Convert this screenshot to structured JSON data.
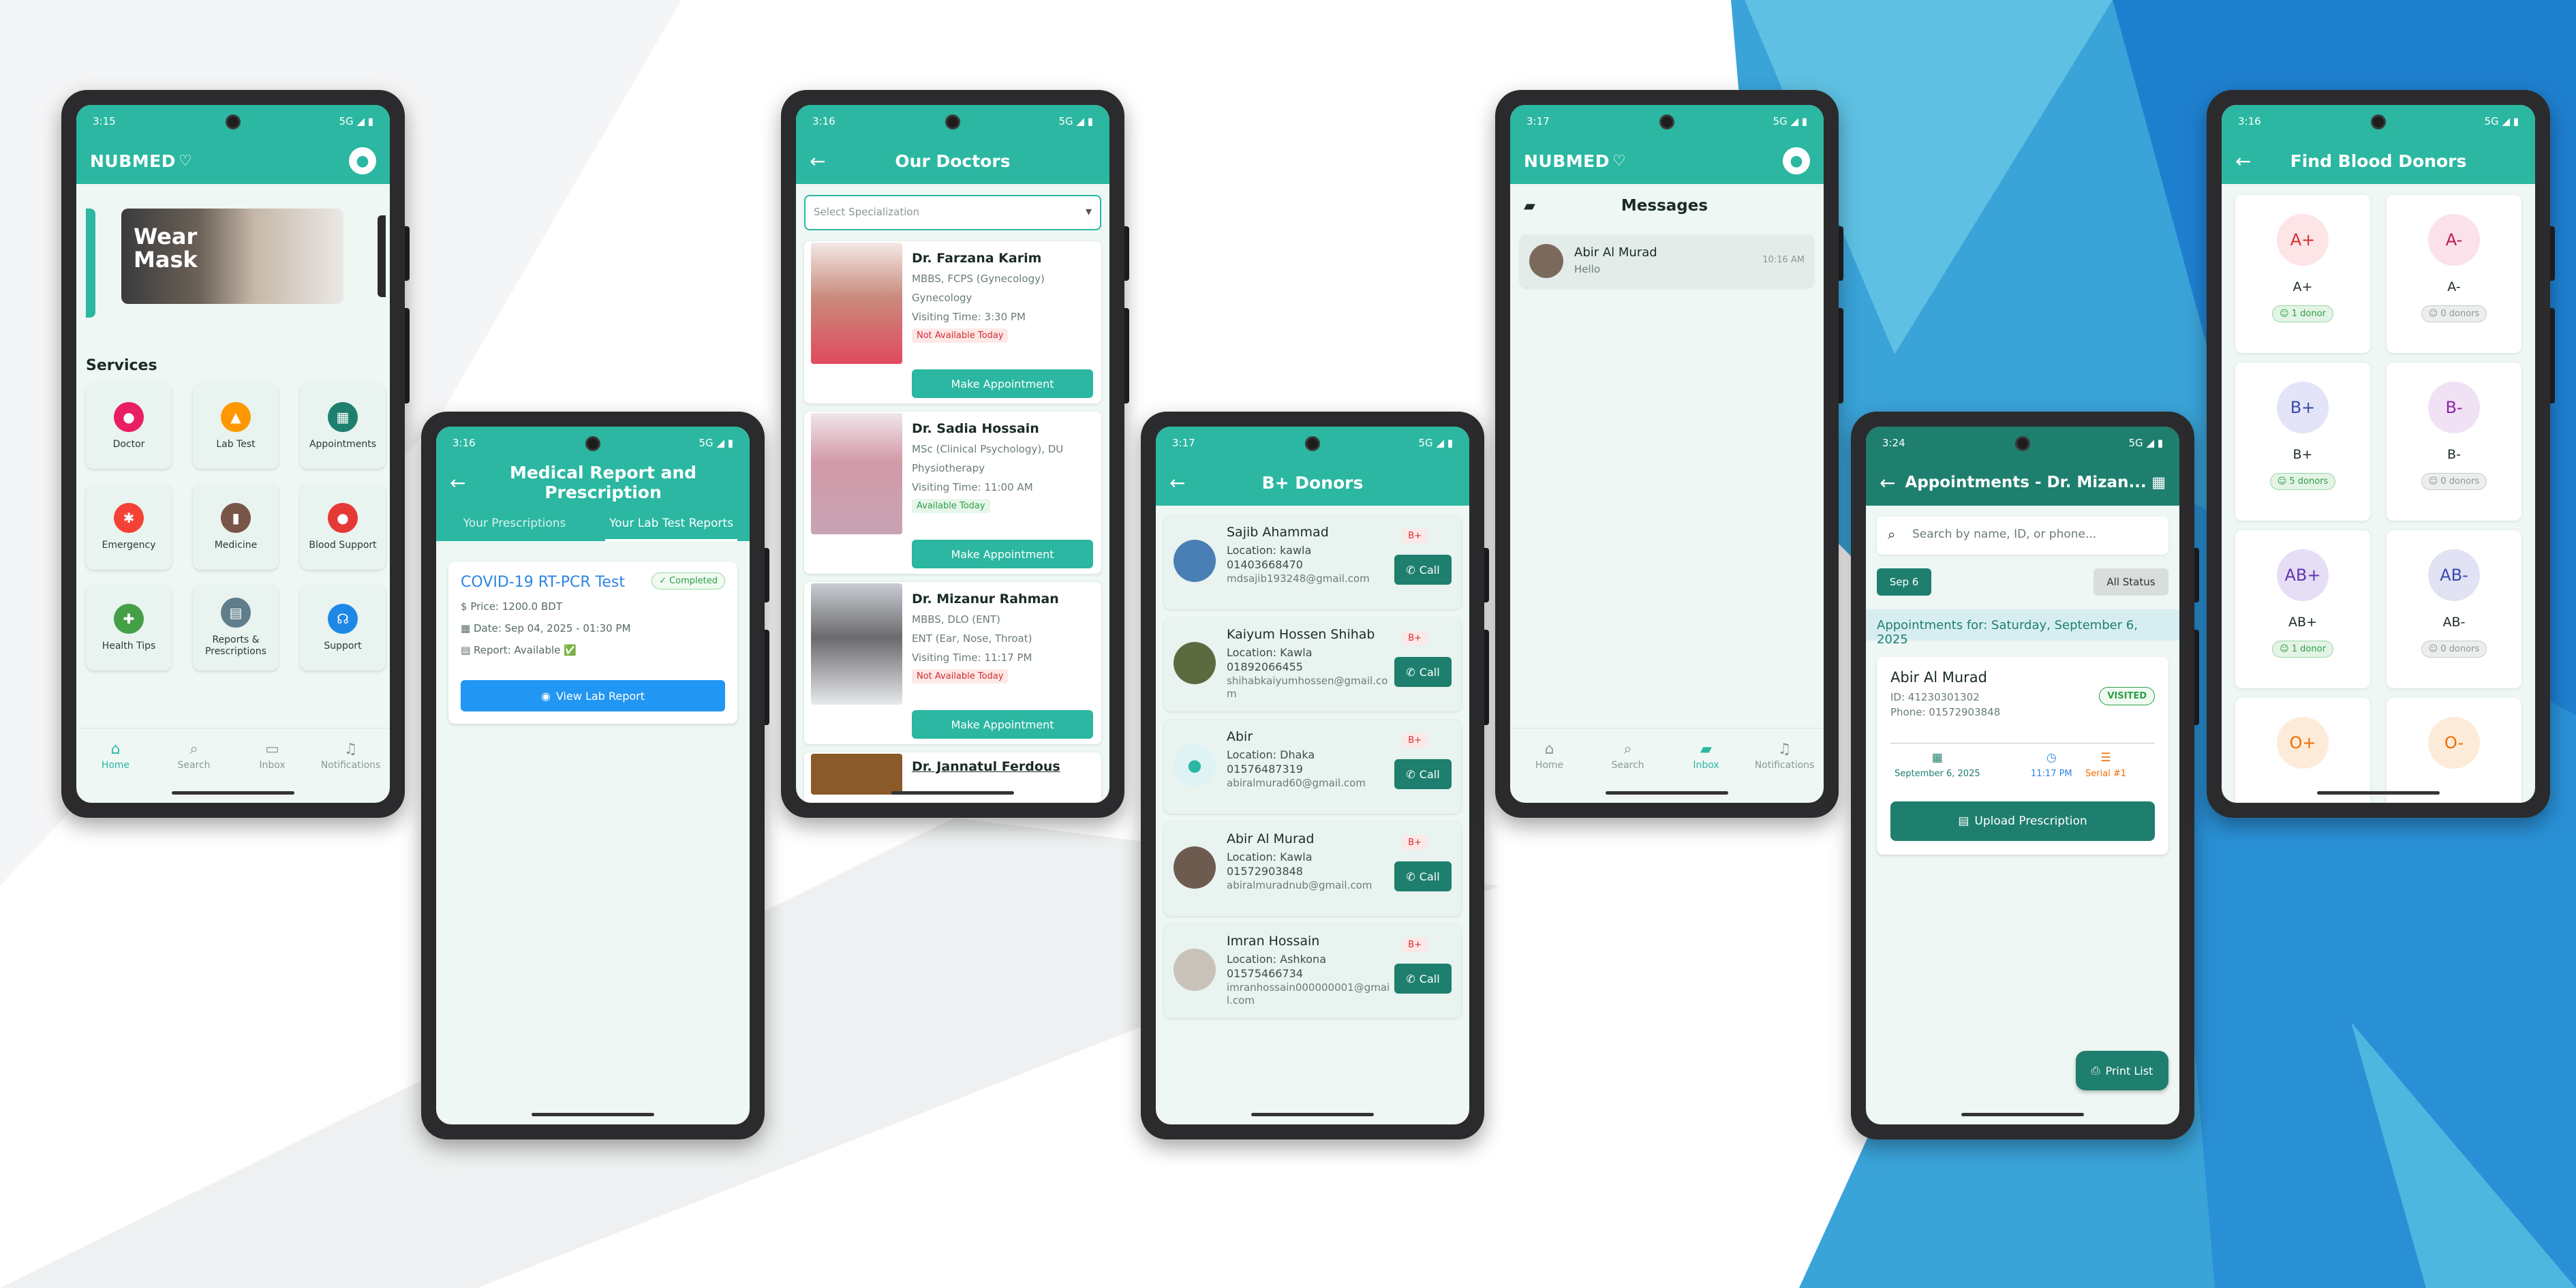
{
  "colors": {
    "primary": "#2bb7a1",
    "primary_dark": "#1e7f6e",
    "accent_blue": "#2196f3",
    "danger": "#d32f2f",
    "success": "#2e9e47"
  },
  "phone1": {
    "status": {
      "time": "3:15",
      "network": "5G"
    },
    "logo": "NUBMED",
    "banner_text": "Wear Mask",
    "services_title": "Services",
    "services": [
      {
        "label": "Doctor",
        "icon": "person-icon",
        "color": "#e91e63",
        "glyph": "●"
      },
      {
        "label": "Lab Test",
        "icon": "flask-icon",
        "color": "#ff9800",
        "glyph": "▲"
      },
      {
        "label": "Appointments",
        "icon": "calendar-icon",
        "color": "#1e7f6e",
        "glyph": "▦"
      },
      {
        "label": "Emergency",
        "icon": "emergency-icon",
        "color": "#f44336",
        "glyph": "✱"
      },
      {
        "label": "Medicine",
        "icon": "medicine-icon",
        "color": "#795548",
        "glyph": "▮"
      },
      {
        "label": "Blood Support",
        "icon": "blood-drop-icon",
        "color": "#e53935",
        "glyph": "●"
      },
      {
        "label": "Health Tips",
        "icon": "shield-icon",
        "color": "#43a047",
        "glyph": "✚"
      },
      {
        "label": "Reports & Prescriptions",
        "icon": "folder-icon",
        "color": "#607d8b",
        "glyph": "▤"
      },
      {
        "label": "Support",
        "icon": "support-icon",
        "color": "#1e88e5",
        "glyph": "☊"
      }
    ],
    "nav": [
      "Home",
      "Search",
      "Inbox",
      "Notifications"
    ]
  },
  "phone2": {
    "status": {
      "time": "3:16",
      "network": "5G"
    },
    "title": "Medical Report and Prescription",
    "tabs": [
      "Your Prescriptions",
      "Your Lab Test Reports"
    ],
    "report": {
      "name": "COVID-19 RT-PCR Test",
      "status": "Completed",
      "price": "Price: 1200.0 BDT",
      "date": "Date: Sep 04, 2025 - 01:30 PM",
      "report": "Report: Available ✅",
      "button": "View Lab Report"
    }
  },
  "phone3": {
    "status": {
      "time": "3:16",
      "network": "5G"
    },
    "title": "Our Doctors",
    "select_placeholder": "Select Specialization",
    "doctors": [
      {
        "name": "Dr. Farzana Karim",
        "degree": "MBBS, FCPS (Gynecology)",
        "spec": "Gynecology",
        "time": "Visiting Time: 3:30 PM",
        "availability": "Not Available Today",
        "button": "Make Appointment"
      },
      {
        "name": "Dr. Sadia Hossain",
        "degree": "MSc (Clinical Psychology), DU",
        "spec": "Physiotherapy",
        "time": "Visiting Time: 11:00 AM",
        "availability": "Available Today",
        "button": "Make Appointment"
      },
      {
        "name": "Dr. Mizanur Rahman",
        "degree": "MBBS, DLO (ENT)",
        "spec": "ENT (Ear, Nose, Throat)",
        "time": "Visiting Time: 11:17 PM",
        "availability": "Not Available Today",
        "button": "Make Appointment"
      }
    ],
    "next_doctor": "Dr. Jannatul Ferdous"
  },
  "phone4": {
    "status": {
      "time": "3:17",
      "network": "5G"
    },
    "title": "B+ Donors",
    "donors": [
      {
        "name": "Sajib Ahammad",
        "location": "Location: kawla",
        "phone": "01403668470",
        "email": "mdsajib193248@gmail.com",
        "group": "B+"
      },
      {
        "name": "Kaiyum Hossen Shihab",
        "location": "Location: Kawla",
        "phone": "01892066455",
        "email": "shihabkaiyumhossen@gmail.com",
        "group": "B+"
      },
      {
        "name": "Abir",
        "location": "Location: Dhaka",
        "phone": "01576487319",
        "email": "abiralmurad60@gmail.com",
        "group": "B+"
      },
      {
        "name": "Abir Al Murad",
        "location": "Location: Kawla",
        "phone": "01572903848",
        "email": "abiralmuradnub@gmail.com",
        "group": "B+"
      },
      {
        "name": "Imran Hossain",
        "location": "Location: Ashkona",
        "phone": "01575466734",
        "email": "imranhossain000000001@gmail.com",
        "group": "B+"
      }
    ],
    "call_label": "Call"
  },
  "phone5": {
    "status": {
      "time": "3:17",
      "network": "5G"
    },
    "logo": "NUBMED",
    "title": "Messages",
    "message": {
      "name": "Abir Al Murad",
      "text": "Hello",
      "time": "10:16 AM"
    },
    "nav": [
      "Home",
      "Search",
      "Inbox",
      "Notifications"
    ]
  },
  "phone6": {
    "status": {
      "time": "3:24",
      "network": "5G"
    },
    "title": "Appointments - Dr. Mizan...",
    "search_placeholder": "Search by name, ID, or phone...",
    "date_chip": "Sep 6",
    "status_chip": "All Status",
    "appointments_for": "Appointments for: Saturday, September 6, 2025",
    "appointment": {
      "name": "Abir Al Murad",
      "id": "ID: 41230301302",
      "phone": "Phone: 01572903848",
      "status": "VISITED",
      "date": "September 6, 2025",
      "time": "11:17 PM",
      "serial": "Serial #1",
      "button": "Upload Prescription"
    },
    "print_label": "Print List"
  },
  "phone7": {
    "status": {
      "time": "3:16",
      "network": "5G"
    },
    "title": "Find Blood Donors",
    "groups": [
      {
        "name": "A+",
        "count": "1 donor",
        "bg": "#fde4e6",
        "fg": "#d32f2f",
        "has": true
      },
      {
        "name": "A-",
        "count": "0 donors",
        "bg": "#fbe1ea",
        "fg": "#c2185b",
        "has": false
      },
      {
        "name": "B+",
        "count": "5 donors",
        "bg": "#e3e4f7",
        "fg": "#3949ab",
        "has": true
      },
      {
        "name": "B-",
        "count": "0 donors",
        "bg": "#f0e1f5",
        "fg": "#8e24aa",
        "has": false
      },
      {
        "name": "AB+",
        "count": "1 donor",
        "bg": "#e6def5",
        "fg": "#5e35b1",
        "has": true
      },
      {
        "name": "AB-",
        "count": "0 donors",
        "bg": "#e1e3f4",
        "fg": "#3949ab",
        "has": false
      },
      {
        "name": "O+",
        "count": "",
        "bg": "#fdebd9",
        "fg": "#ef6c00",
        "has": false
      },
      {
        "name": "O-",
        "count": "",
        "bg": "#fdebd9",
        "fg": "#ef6c00",
        "has": false
      }
    ]
  }
}
